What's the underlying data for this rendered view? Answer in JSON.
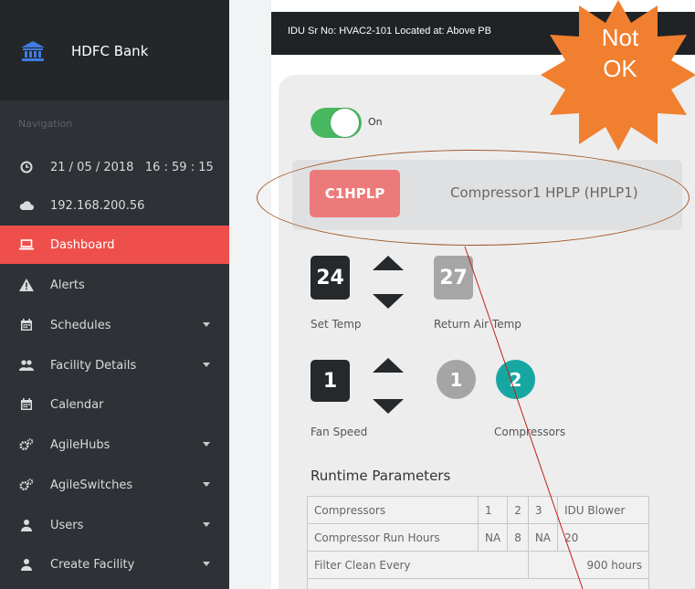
{
  "brand": {
    "name": "HDFC Bank",
    "icon": "bank-icon"
  },
  "nav": {
    "title": "Navigation",
    "datetime": "21 / 05 / 2018   16 : 59 : 15",
    "ip": "192.168.200.56",
    "items": [
      {
        "label": "Dashboard",
        "icon": "laptop-icon",
        "active": true,
        "has_caret": false
      },
      {
        "label": "Alerts",
        "icon": "warning-icon",
        "active": false,
        "has_caret": false
      },
      {
        "label": "Schedules",
        "icon": "calendar-icon",
        "active": false,
        "has_caret": true
      },
      {
        "label": "Facility Details",
        "icon": "users-icon",
        "active": false,
        "has_caret": true
      },
      {
        "label": "Calendar",
        "icon": "calendar-icon",
        "active": false,
        "has_caret": false
      },
      {
        "label": "AgileHubs",
        "icon": "cogs-icon",
        "active": false,
        "has_caret": true
      },
      {
        "label": "AgileSwitches",
        "icon": "cogs-icon",
        "active": false,
        "has_caret": true
      },
      {
        "label": "Users",
        "icon": "user-icon",
        "active": false,
        "has_caret": true
      },
      {
        "label": "Create Facility",
        "icon": "user-icon",
        "active": false,
        "has_caret": true
      }
    ]
  },
  "header": {
    "text": "IDU Sr No: HVAC2-101 Located at: Above PB"
  },
  "annotation": {
    "badge_text_line1": "Not",
    "badge_text_line2": "OK",
    "badge_color": "#f07f2f"
  },
  "power": {
    "label": "On",
    "state": true,
    "color": "#48b861"
  },
  "alarm": {
    "code": "C1HPLP",
    "description": "Compressor1 HPLP (HPLP1)",
    "color": "#ed7a7a"
  },
  "temperature": {
    "set_value": "24",
    "set_label": "Set Temp",
    "return_value": "27",
    "return_label": "Return Air Temp"
  },
  "fan": {
    "value": "1",
    "label": "Fan Speed"
  },
  "compressors": {
    "label": "Compressors",
    "items": [
      {
        "value": "1",
        "color": "#a5a5a5"
      },
      {
        "value": "2",
        "color": "#17a7a3"
      }
    ]
  },
  "runtime": {
    "title": "Runtime Parameters",
    "rows": [
      [
        "Compressors",
        "1",
        "2",
        "3",
        "IDU Blower"
      ],
      [
        "Compressor Run Hours",
        "NA",
        "8",
        "NA",
        "20"
      ],
      [
        "Filter Clean Every",
        "900 hours"
      ]
    ]
  }
}
